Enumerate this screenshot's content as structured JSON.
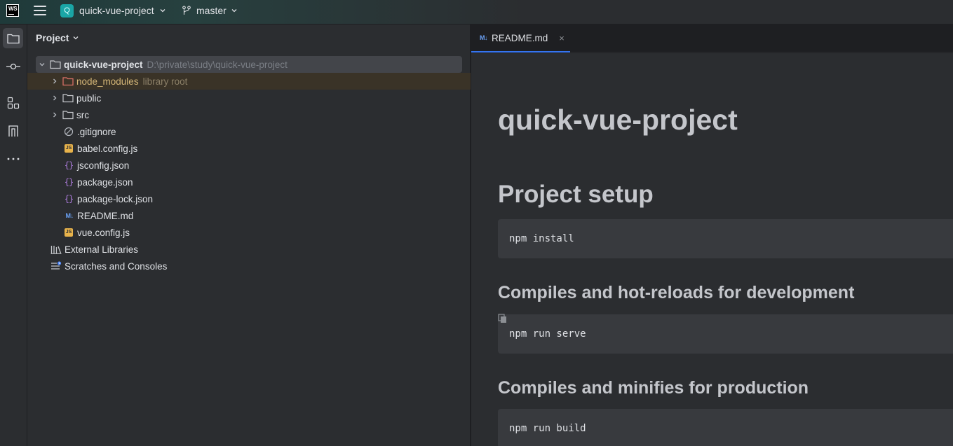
{
  "topbar": {
    "logo_text": "WS",
    "project_badge": "Q",
    "project_name": "quick-vue-project",
    "branch_name": "master"
  },
  "toolstrip": {
    "icons": [
      "project-icon",
      "commit-icon",
      "structure-icon",
      "pull-requests-icon",
      "more-icon"
    ]
  },
  "project_panel": {
    "title": "Project",
    "root": {
      "name": "quick-vue-project",
      "path": "D:\\private\\study\\quick-vue-project"
    },
    "items": [
      {
        "name": "node_modules",
        "hint": "library root",
        "type": "folder"
      },
      {
        "name": "public",
        "type": "folder"
      },
      {
        "name": "src",
        "type": "folder"
      },
      {
        "name": ".gitignore",
        "type": "ignore"
      },
      {
        "name": "babel.config.js",
        "type": "js"
      },
      {
        "name": "jsconfig.json",
        "type": "json"
      },
      {
        "name": "package.json",
        "type": "json"
      },
      {
        "name": "package-lock.json",
        "type": "json"
      },
      {
        "name": "README.md",
        "type": "md"
      },
      {
        "name": "vue.config.js",
        "type": "js"
      }
    ],
    "external_libraries": "External Libraries",
    "scratches": "Scratches and Consoles",
    "js_badge": "JS",
    "json_badge": "{}",
    "md_badge": "M↓"
  },
  "editor": {
    "tab": {
      "icon": "M↓",
      "label": "README.md",
      "close": "×"
    },
    "markdown": {
      "h1": "quick-vue-project",
      "h2": "Project setup",
      "code1": "npm install",
      "h3_1": "Compiles and hot-reloads for development",
      "code2": "npm run serve",
      "h3_2": "Compiles and minifies for production",
      "code3": "npm run build"
    }
  }
}
